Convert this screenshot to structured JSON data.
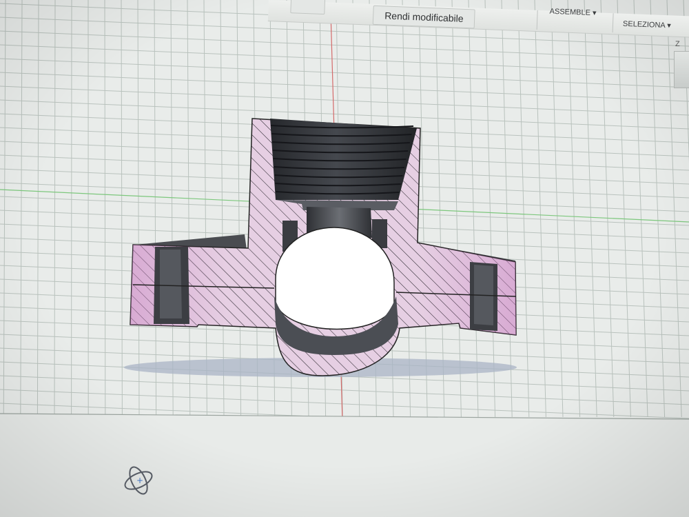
{
  "toolbar": {
    "partial_label": "",
    "editable_button": "Rendi modificabile",
    "assemble_menu": "ASSEMBLE",
    "select_menu": "SELEZIONA"
  },
  "viewcube": {
    "axis_label": "Z"
  },
  "viewport": {
    "background": "#e9ecea",
    "grid_color": "#b9c2bd",
    "section_fill": "#e6cfe3",
    "hatch_color": "#2f2a33",
    "body_dark": "#3b3d42",
    "red_axis": "#d46a6a",
    "green_axis": "#7cc77c"
  },
  "icons": {
    "orbit": "orbit-icon",
    "dropdown": "chevron-down-icon"
  }
}
